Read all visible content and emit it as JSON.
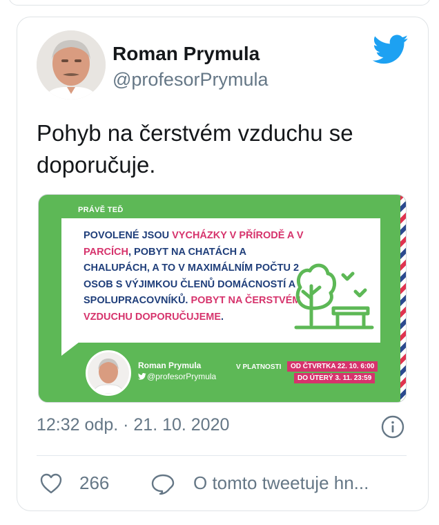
{
  "author": {
    "name": "Roman Prymula",
    "handle": "@profesorPrymula"
  },
  "tweet": {
    "text": "Pohyb na čerstvém vzduchu se doporučuje.",
    "timestamp": "12:32 odp. · 21. 10. 2020"
  },
  "media": {
    "badge": "PRÁVĚ TEĎ",
    "message": [
      {
        "text": "Povolené jsou ",
        "highlight": false
      },
      {
        "text": "vycházky v přírodě a v parcích",
        "highlight": true
      },
      {
        "text": ", pobyt na chatách a chalupách, a to v maximálním počtu 2 osob s výjimkou členů domácností a spolupracovníků. ",
        "highlight": false
      },
      {
        "text": "Pobyt na čerstvém vzduchu doporučujeme",
        "highlight": true
      },
      {
        "text": ".",
        "highlight": false
      }
    ],
    "author_name": "Roman Prymula",
    "author_handle": "@profesorPrymula",
    "validity_label": "V PLATNOSTI",
    "date_from": "OD ČTVRTKA 22. 10. 6:00",
    "date_to": "DO ÚTERÝ 3. 11. 23:59"
  },
  "actions": {
    "like_count": "266",
    "reply_text": "O tomto tweetuje hn..."
  },
  "colors": {
    "twitter_blue": "#1da1f2",
    "green": "#5db856",
    "pink": "#d6336c",
    "navy": "#1f3e7a",
    "gray_text": "#657786"
  }
}
